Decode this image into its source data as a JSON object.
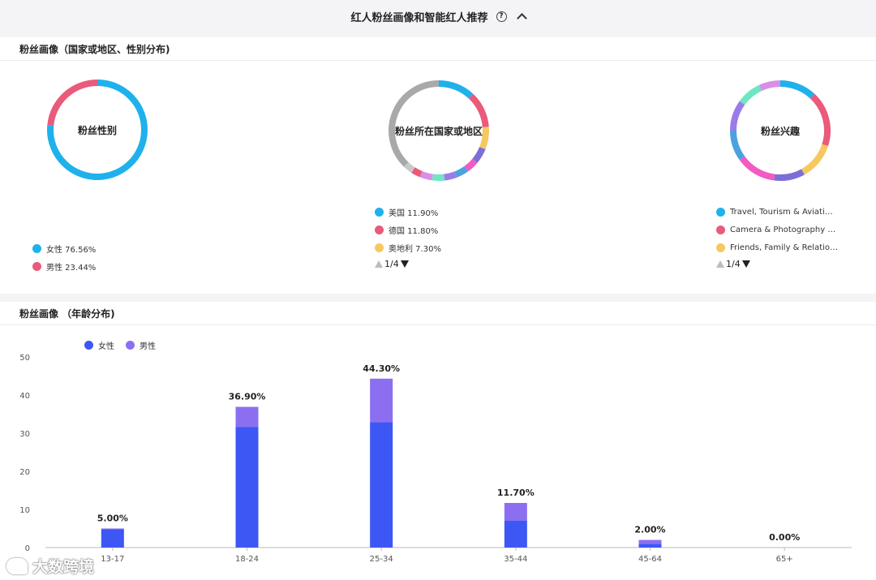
{
  "header": {
    "title": "红人粉丝画像和智能红人推荐",
    "help_icon": "question-circle-icon",
    "collapse_icon": "chevron-up-icon"
  },
  "panel_geo": {
    "title": "粉丝画像（国家或地区、性别分布)",
    "gender": {
      "center_label": "粉丝性别",
      "legend": [
        {
          "label": "女性 76.56%",
          "color": "#1fb1ec"
        },
        {
          "label": "男性 23.44%",
          "color": "#ea5a7b"
        }
      ]
    },
    "country": {
      "center_label": "粉丝所在国家或地区",
      "legend": [
        {
          "label": "美国 11.90%",
          "color": "#1fb1ec"
        },
        {
          "label": "德国 11.80%",
          "color": "#ea5a7b"
        },
        {
          "label": "奥地利 7.30%",
          "color": "#f6c85f"
        }
      ],
      "pager": "1/4"
    },
    "interest": {
      "center_label": "粉丝兴趣",
      "legend": [
        {
          "label": "Travel, Tourism & Aviati…",
          "color": "#1fb1ec"
        },
        {
          "label": "Camera & Photography …",
          "color": "#ea5a7b"
        },
        {
          "label": "Friends, Family & Relatio…",
          "color": "#f6c85f"
        }
      ],
      "pager": "1/4"
    }
  },
  "panel_age": {
    "title": "粉丝画像 （年龄分布)",
    "legend": [
      {
        "label": "女性",
        "color": "#3d57f5"
      },
      {
        "label": "男性",
        "color": "#8c6ff0"
      }
    ]
  },
  "watermark": {
    "text": "大数跨境"
  },
  "chart_data": [
    {
      "type": "pie",
      "variant": "donut",
      "title": "粉丝性别",
      "categories": [
        "女性",
        "男性"
      ],
      "values": [
        76.56,
        23.44
      ],
      "colors": [
        "#1fb1ec",
        "#ea5a7b"
      ]
    },
    {
      "type": "pie",
      "variant": "donut",
      "title": "粉丝所在国家或地区",
      "categories": [
        "美国",
        "德国",
        "奥地利",
        "",
        "",
        "",
        "",
        "",
        "",
        "",
        "",
        ""
      ],
      "values": [
        11.9,
        11.8,
        7.3,
        5,
        4,
        4,
        4,
        4,
        4,
        3,
        3,
        37.7
      ],
      "colors": [
        "#1fb1ec",
        "#ea5a7b",
        "#f6c85f",
        "#7b6fd6",
        "#f25bc4",
        "#4aa3df",
        "#9b7bea",
        "#6ee6c4",
        "#d98fe8",
        "#ea5a7b",
        "#c9c9c9",
        "#a9a9a9"
      ]
    },
    {
      "type": "pie",
      "variant": "donut",
      "title": "粉丝兴趣",
      "categories": [
        "Travel, Tourism & Aviati…",
        "Camera & Photography …",
        "Friends, Family & Relatio…",
        "",
        "",
        "",
        "",
        "",
        ""
      ],
      "values": [
        12,
        18,
        12,
        10,
        13,
        10,
        10,
        8,
        7
      ],
      "colors": [
        "#1fb1ec",
        "#ea5a7b",
        "#f6c85f",
        "#7b6fd6",
        "#f25bc4",
        "#4aa3df",
        "#9b7bea",
        "#6ee6c4",
        "#d98fe8"
      ]
    },
    {
      "type": "bar",
      "stacked": true,
      "title": "粉丝画像 （年龄分布)",
      "categories": [
        "13-17",
        "18-24",
        "25-34",
        "35-44",
        "45-64",
        "65+"
      ],
      "series": [
        {
          "name": "女性",
          "values": [
            4.8,
            31.6,
            32.9,
            7.1,
            1.0,
            0
          ],
          "color": "#3d57f5"
        },
        {
          "name": "男性",
          "values": [
            0.2,
            5.3,
            11.4,
            4.6,
            1.0,
            0
          ],
          "color": "#8c6ff0"
        }
      ],
      "data_labels": [
        "5.00%",
        "36.90%",
        "44.30%",
        "11.70%",
        "2.00%",
        "0.00%"
      ],
      "yticks": [
        0,
        10,
        20,
        30,
        40,
        50
      ],
      "ylim": [
        0,
        50
      ],
      "legend_position": "top-left",
      "grid": false
    }
  ]
}
